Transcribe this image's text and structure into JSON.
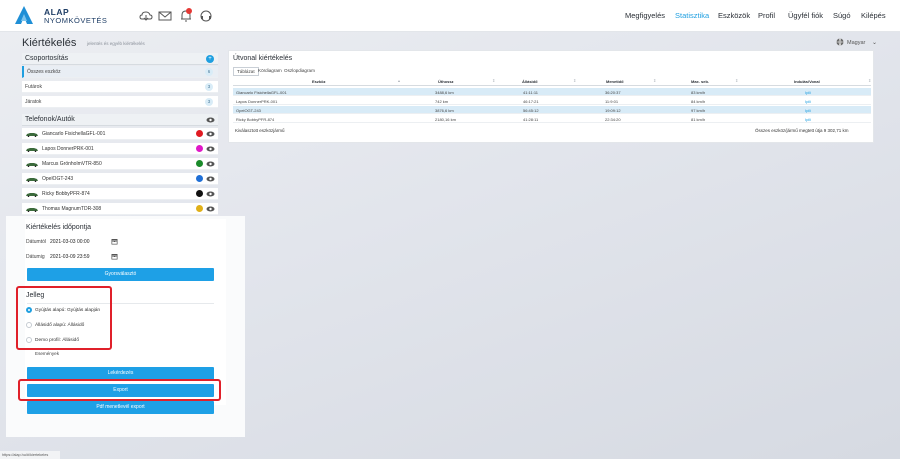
{
  "brand": {
    "line1": "ALAP",
    "line2": "NYOMKÖVETÉS",
    "logo_color": "#1f8fd6"
  },
  "top_icons": [
    "cloud-icon",
    "mail-icon",
    "bell-icon",
    "headset-icon"
  ],
  "nav": [
    {
      "label": "Megfigyelés",
      "active": false
    },
    {
      "label": "Statisztika",
      "active": true
    },
    {
      "label": "Eszközök",
      "active": false
    },
    {
      "label": "Profil",
      "active": false
    },
    {
      "label": "Ügyfél fiók",
      "active": false
    },
    {
      "label": "Súgó",
      "active": false
    },
    {
      "label": "Kilépés",
      "active": false
    }
  ],
  "page": {
    "title": "Kiértékelés",
    "subtitle": "jelentés és egyéb kiértékelés",
    "language": "Magyar"
  },
  "groups": {
    "header": "Csoportosítás",
    "items": [
      {
        "label": "Összes eszköz",
        "count": "6"
      },
      {
        "label": "Futárok",
        "count": "3"
      },
      {
        "label": "Járatok",
        "count": "3"
      }
    ]
  },
  "vehicles": {
    "header": "Telefonok/Autók",
    "items": [
      {
        "name": "Giancarlo FisichellaGFL-001",
        "color": "#e01b22",
        "car_color": "#3c6b3c"
      },
      {
        "name": "Lapos DonnerPRK-001",
        "color": "#e018c8",
        "car_color": "#3c6b3c"
      },
      {
        "name": "Marcus GrönholmVTR-850",
        "color": "#1a8a2a",
        "car_color": "#3c6b3c"
      },
      {
        "name": "OpelOGT-243",
        "color": "#1f6fd6",
        "car_color": "#3c6b3c"
      },
      {
        "name": "Ricky BobbyPFR-874",
        "color": "#111111",
        "car_color": "#3c6b3c"
      },
      {
        "name": "Thomas MagnumTDR-308",
        "color": "#e0b018",
        "car_color": "#3c6b3c"
      }
    ]
  },
  "form": {
    "title": "Kiértékelés időpontja",
    "from_label": "Dátumtól",
    "from_value": "2021-03-03 00:00",
    "to_label": "Dátumig",
    "to_value": "2021-03-09 23:59",
    "quick_button": "Gyorsválasztó",
    "jelleg_title": "Jelleg",
    "options": [
      {
        "label": "Gyújtás alapú: Gyújtás alapján",
        "selected": true
      },
      {
        "label": "Állásidő alapú: Állásidő",
        "selected": false
      },
      {
        "label": "Demo profil: Állásidő",
        "selected": false
      }
    ],
    "events_label": "Események",
    "query_button": "Lekérdezés",
    "export_button": "Export",
    "pdf_button": "Pdf menetlevél export"
  },
  "report": {
    "title": "Útvonal kiértékelés",
    "tabs": [
      {
        "label": "Táblázat",
        "active": true
      },
      {
        "label": "Kördiagram",
        "active": false
      },
      {
        "label": "Oszlopdiagram",
        "active": false
      }
    ],
    "columns": [
      "Eszköz",
      "Úthossz",
      "Állásidő",
      "Menetidő",
      "Max. seb.",
      "Indulás/Vonal"
    ],
    "rows": [
      {
        "cells": [
          "Giancarlo FisichellaGFL-001",
          "3488,6 km",
          "41:11:11",
          "36:20:37",
          "83 km/h",
          "Ipili"
        ],
        "highlight": true
      },
      {
        "cells": [
          "Lapos DonnerPRK-001",
          "742 km",
          "46:17:21",
          "11:9:01",
          "84 km/h",
          "Ipili"
        ],
        "highlight": false
      },
      {
        "cells": [
          "OpelOGT-243",
          "3876,6 km",
          "56:45:12",
          "19:09:12",
          "97 km/h",
          "Ipili"
        ],
        "highlight": true
      },
      {
        "cells": [
          "Ricky BobbyPFR-874",
          "2180,16 km",
          "41:28:11",
          "22:34:20",
          "81 km/h",
          "Ipili"
        ],
        "highlight": false
      }
    ],
    "footer_left": "Kiválasztott eszközjármű",
    "footer_right": "Összes eszköz/jármű megtett útja 9 302,71 km"
  },
  "status_url": "https://alap.hu/#/kiertekeles"
}
